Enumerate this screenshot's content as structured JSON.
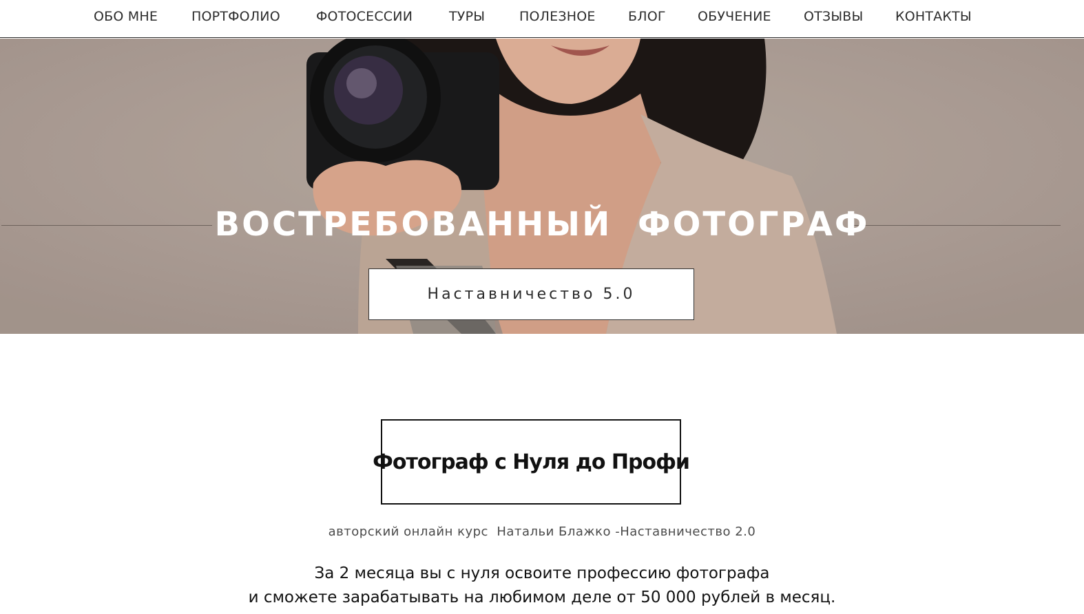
{
  "nav": {
    "items": [
      {
        "label": "ОБО МНЕ"
      },
      {
        "label": "ПОРТФОЛИО"
      },
      {
        "label": "ФОТОСЕССИИ"
      },
      {
        "label": "ТУРЫ"
      },
      {
        "label": "ПОЛЕЗНОЕ"
      },
      {
        "label": "БЛОГ"
      },
      {
        "label": "ОБУЧЕНИЕ"
      },
      {
        "label": "ОТЗЫВЫ"
      },
      {
        "label": "КОНТАКТЫ"
      }
    ]
  },
  "hero": {
    "title": "ВОСТРЕБОВАННЫЙ ФОТОГРАФ",
    "button_label": "Наставничество 5.0"
  },
  "course": {
    "title": "Фотограф с Нуля до Профи",
    "subtitle": "авторский онлайн курс  Натальи Блажко -Наставничество 2.0",
    "promo_line1": "За 2 месяца вы с нуля освоите профессию фотографа",
    "promo_line2": "и сможете зарабатывать на любимом деле от 50 000 рублей в месяц."
  },
  "colors": {
    "hero_background": "#b3a59c",
    "accent_dark": "#111111"
  }
}
